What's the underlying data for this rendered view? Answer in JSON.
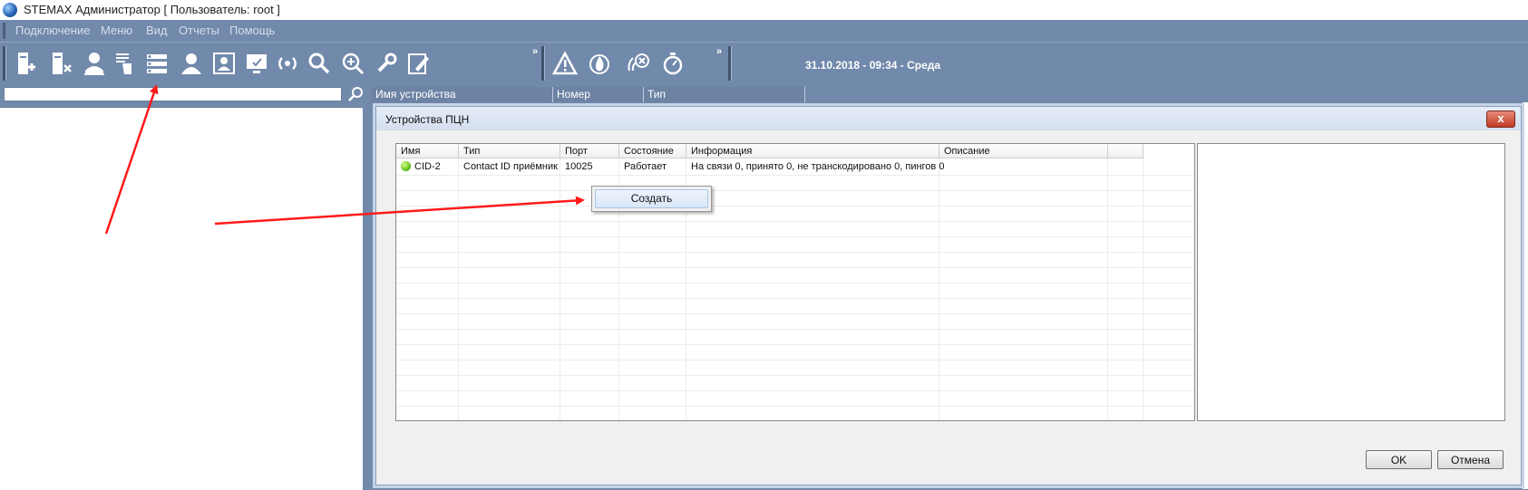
{
  "window": {
    "title": "STEMAX Администратор [ Пользователь: root ]"
  },
  "menu": [
    "Подключение",
    "Меню",
    "Вид",
    "Отчеты",
    "Помощь"
  ],
  "toolbar": {
    "group1_icons": [
      "device-connect-icon",
      "device-remove-icon",
      "user-stamp-icon",
      "hand-list-icon",
      "server-list-icon",
      "user-icon",
      "user-card-icon",
      "monitor-check-icon",
      "signal-icon",
      "search-icon",
      "zoom-plus-icon",
      "wrench-icon",
      "edit-icon"
    ],
    "group2_icons": [
      "warning-icon",
      "fire-icon",
      "no-signal-icon",
      "stopwatch-icon"
    ],
    "overflow_label": "»",
    "datetime": "31.10.2018 - 09:34 - Среда"
  },
  "left_panel": {
    "search_value": ""
  },
  "main_grid": {
    "columns": [
      "Имя устройства",
      "Номер",
      "Тип"
    ]
  },
  "dialog": {
    "title": "Устройства ПЦН",
    "close_label": "x",
    "columns": [
      "Имя",
      "Тип",
      "Порт",
      "Состояние",
      "Информация",
      "Описание"
    ],
    "rows": [
      {
        "status_color": "#66c21a",
        "name": "CID-2",
        "type": "Contact ID приёмник",
        "port": "10025",
        "state": "Работает",
        "info": "На связи 0, принято 0, не транскодировано 0, пингов 0",
        "desc": ""
      }
    ],
    "context_menu": [
      "Создать"
    ],
    "ok_label": "OK",
    "cancel_label": "Отмена"
  },
  "annotations": {
    "arrow_color": "#ff1a1a"
  }
}
